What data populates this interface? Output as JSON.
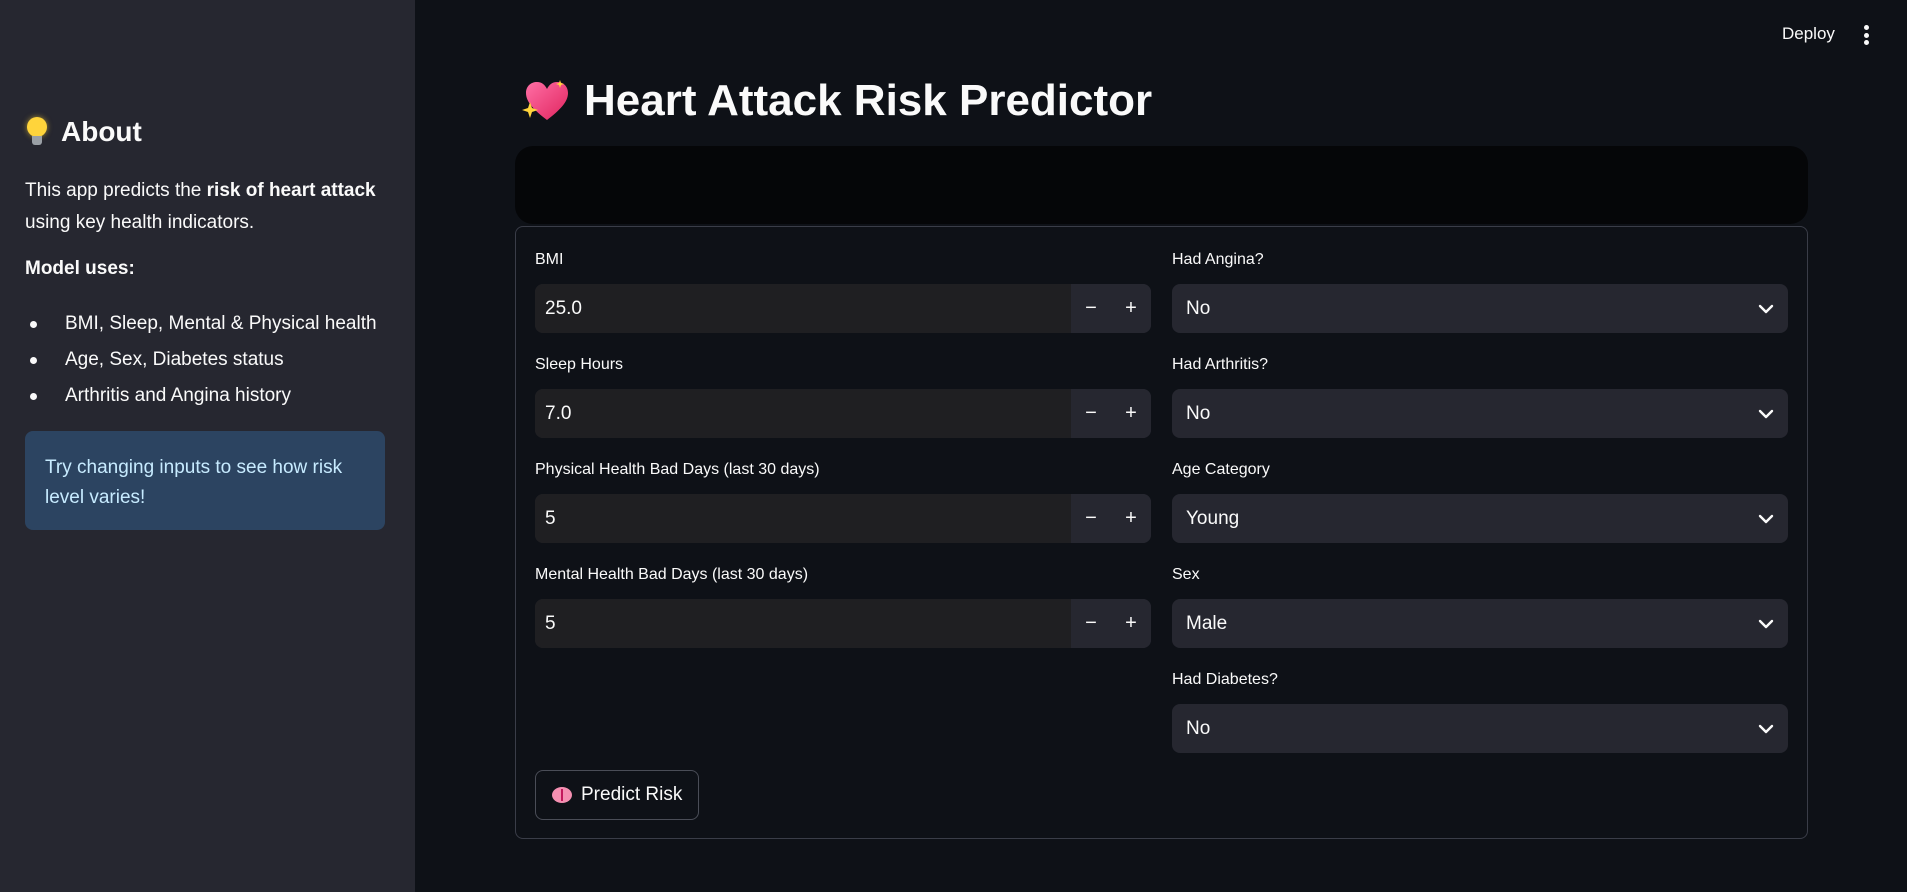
{
  "header": {
    "deploy_label": "Deploy",
    "menu_icon": "kebab-menu-icon"
  },
  "sidebar": {
    "title": "About",
    "title_icon": "lightbulb-icon",
    "intro_before": "This app predicts the ",
    "intro_bold": "risk of heart attack",
    "intro_after": " using key health indicators.",
    "model_heading": "Model uses:",
    "items": [
      {
        "label": "BMI, Sleep, Mental & Physical health"
      },
      {
        "label": "Age, Sex, Diabetes status"
      },
      {
        "label": "Arthritis and Angina history"
      }
    ],
    "info_text": "Try changing inputs to see how risk level varies!",
    "info_color": "#2c4461"
  },
  "main": {
    "title": "Heart Attack Risk Predictor",
    "title_icon": "sparkling-heart-icon",
    "left_fields": [
      {
        "label": "BMI",
        "value": "25.0"
      },
      {
        "label": "Sleep Hours",
        "value": "7.0"
      },
      {
        "label": "Physical Health Bad Days (last 30 days)",
        "value": "5"
      },
      {
        "label": "Mental Health Bad Days (last 30 days)",
        "value": "5"
      }
    ],
    "right_fields": [
      {
        "label": "Had Angina?",
        "value": "No"
      },
      {
        "label": "Had Arthritis?",
        "value": "No"
      },
      {
        "label": "Age Category",
        "value": "Young"
      },
      {
        "label": "Sex",
        "value": "Male"
      },
      {
        "label": "Had Diabetes?",
        "value": "No"
      }
    ],
    "stepper_minus": "−",
    "stepper_plus": "+",
    "predict_label": "Predict Risk",
    "predict_icon": "brain-icon"
  }
}
